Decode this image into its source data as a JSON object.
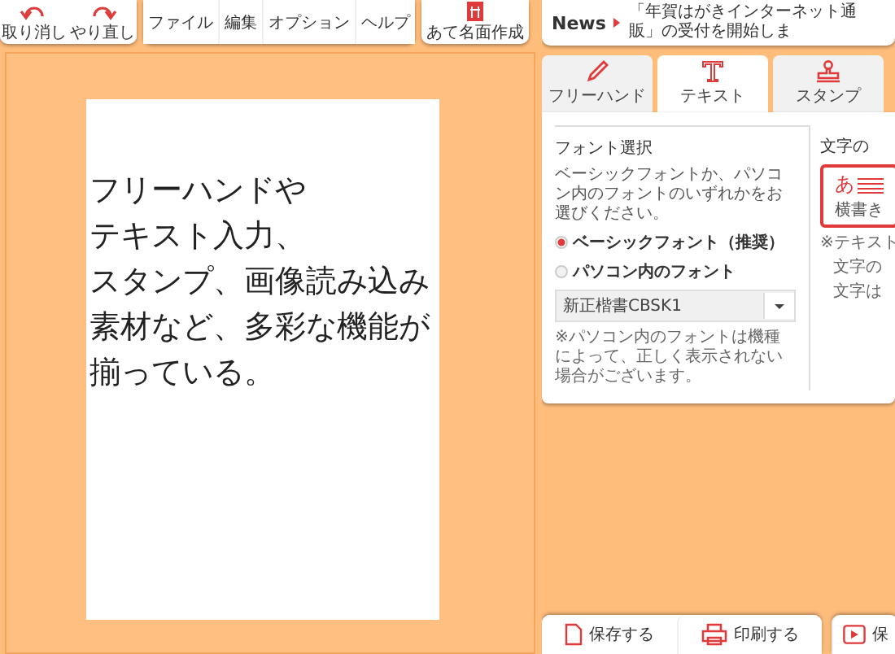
{
  "toolbar": {
    "edit_buttons": [
      {
        "label": "取り消し",
        "kind": "undo"
      },
      {
        "label": "やり直し",
        "kind": "redo"
      }
    ],
    "menu": [
      "ファイル",
      "編集",
      "オプション",
      "ヘルプ"
    ],
    "address_button": {
      "label": "あて名面作成"
    }
  },
  "canvas": {
    "lines": [
      "フリーハンドや",
      "テキスト入力、",
      "スタンプ、画像読み込み",
      "素材など、多彩な機能が",
      "揃っている。"
    ]
  },
  "news": {
    "label": "News",
    "text": "「年賀はがきインターネット通販」の受付を開始しま"
  },
  "tabs": [
    {
      "label": "フリーハンド",
      "kind": "pen",
      "selected": false
    },
    {
      "label": "テキスト",
      "kind": "text",
      "selected": true
    },
    {
      "label": "スタンプ",
      "kind": "stamp",
      "selected": false
    }
  ],
  "font_panel": {
    "title": "フォント選択",
    "description": "ベーシックフォントか、パソコン内のフォントのいずれかをお選びください。",
    "options": [
      {
        "label": "ベーシックフォント（推奨）",
        "selected": true
      },
      {
        "label": "パソコン内のフォント",
        "selected": false
      }
    ],
    "font_select": {
      "value": "新正楷書CBSK1"
    },
    "note": "※パソコン内のフォントは機種によって、正しく表示されない場合がございます。"
  },
  "direction_panel": {
    "title": "文字の",
    "card": {
      "glyph": "あ",
      "label": "横書き"
    },
    "notes": [
      "※テキスト",
      "文字の",
      "文字は"
    ]
  },
  "bottom_buttons": [
    {
      "label": "保存する",
      "kind": "save"
    },
    {
      "label": "印刷する",
      "kind": "print"
    },
    {
      "label": "保",
      "kind": "play"
    }
  ]
}
